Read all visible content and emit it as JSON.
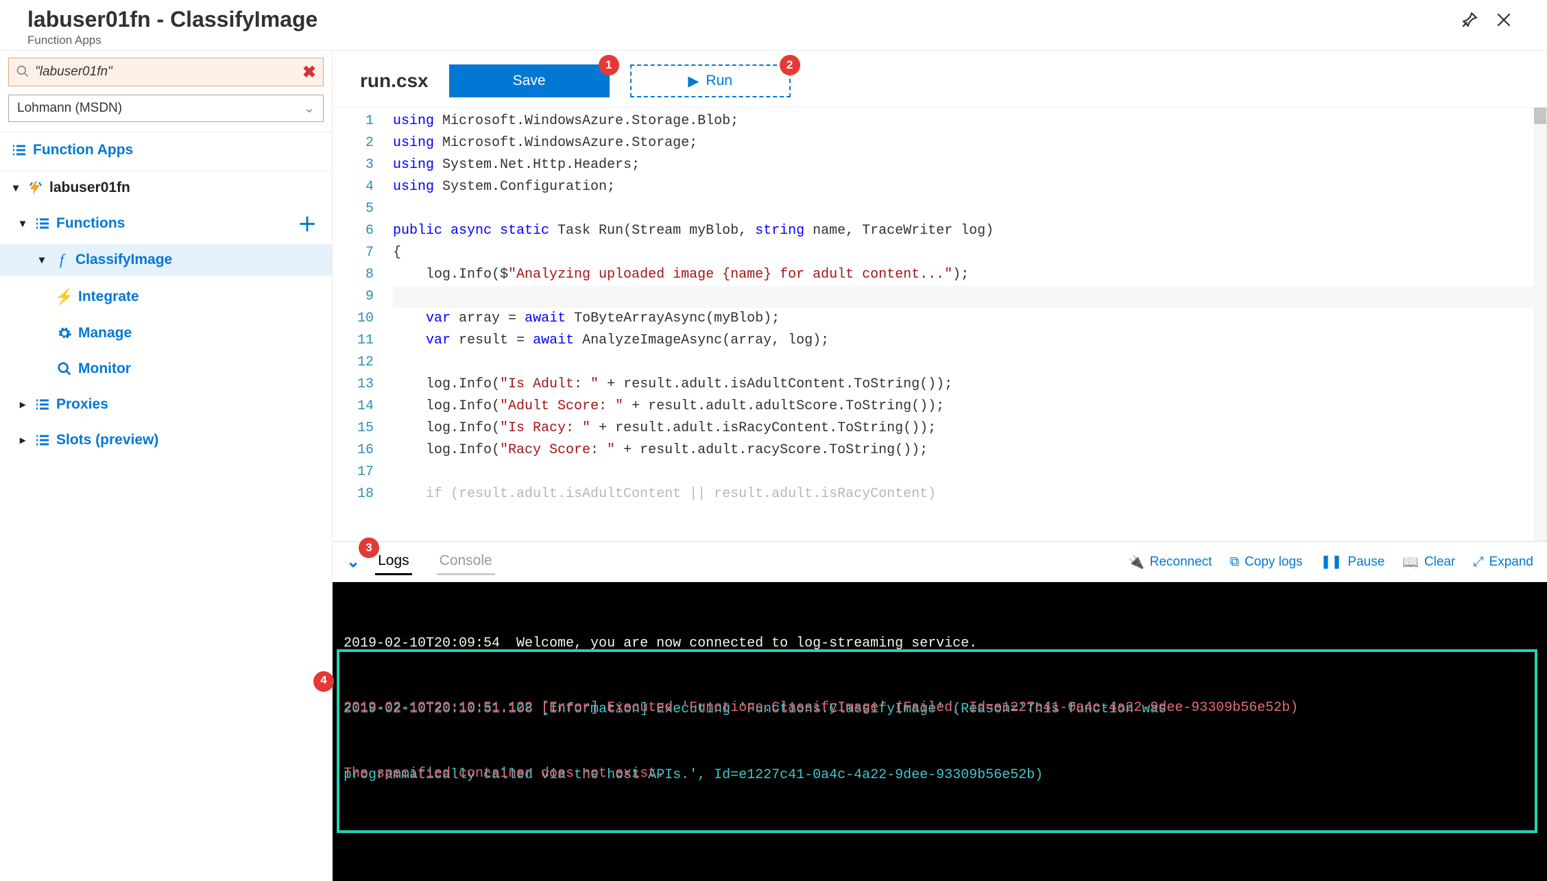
{
  "header": {
    "title": "labuser01fn - ClassifyImage",
    "subtitle": "Function Apps"
  },
  "sidebar": {
    "search_value": "\"labuser01fn\"",
    "subscription": "Lohmann (MSDN)",
    "nav": {
      "function_apps": "Function Apps",
      "app_name": "labuser01fn",
      "functions": "Functions",
      "selected_fn": "ClassifyImage",
      "integrate": "Integrate",
      "manage": "Manage",
      "monitor": "Monitor",
      "proxies": "Proxies",
      "slots": "Slots (preview)"
    }
  },
  "toolbar": {
    "filename": "run.csx",
    "save_label": "Save",
    "run_label": "Run"
  },
  "callouts": {
    "c1": "1",
    "c2": "2",
    "c3": "3",
    "c4": "4"
  },
  "code_lines": [
    [
      {
        "c": "kw",
        "t": "using"
      },
      {
        "c": "",
        "t": " Microsoft.WindowsAzure.Storage.Blob;"
      }
    ],
    [
      {
        "c": "kw",
        "t": "using"
      },
      {
        "c": "",
        "t": " Microsoft.WindowsAzure.Storage;"
      }
    ],
    [
      {
        "c": "kw",
        "t": "using"
      },
      {
        "c": "",
        "t": " System.Net.Http.Headers;"
      }
    ],
    [
      {
        "c": "kw",
        "t": "using"
      },
      {
        "c": "",
        "t": " System.Configuration;"
      }
    ],
    [
      {
        "c": "",
        "t": ""
      }
    ],
    [
      {
        "c": "kw",
        "t": "public async static"
      },
      {
        "c": "",
        "t": " Task Run(Stream myBlob, "
      },
      {
        "c": "kw",
        "t": "string"
      },
      {
        "c": "",
        "t": " name, TraceWriter log)"
      }
    ],
    [
      {
        "c": "",
        "t": "{"
      }
    ],
    [
      {
        "c": "",
        "t": "    log.Info($"
      },
      {
        "c": "str",
        "t": "\"Analyzing uploaded image {name} for adult content...\""
      },
      {
        "c": "",
        "t": ");"
      }
    ],
    [
      {
        "c": "",
        "t": ""
      }
    ],
    [
      {
        "c": "",
        "t": "    "
      },
      {
        "c": "kw",
        "t": "var"
      },
      {
        "c": "",
        "t": " array = "
      },
      {
        "c": "kw",
        "t": "await"
      },
      {
        "c": "",
        "t": " ToByteArrayAsync(myBlob);"
      }
    ],
    [
      {
        "c": "",
        "t": "    "
      },
      {
        "c": "kw",
        "t": "var"
      },
      {
        "c": "",
        "t": " result = "
      },
      {
        "c": "kw",
        "t": "await"
      },
      {
        "c": "",
        "t": " AnalyzeImageAsync(array, log);"
      }
    ],
    [
      {
        "c": "",
        "t": ""
      }
    ],
    [
      {
        "c": "",
        "t": "    log.Info("
      },
      {
        "c": "str",
        "t": "\"Is Adult: \""
      },
      {
        "c": "",
        "t": " + result.adult.isAdultContent.ToString());"
      }
    ],
    [
      {
        "c": "",
        "t": "    log.Info("
      },
      {
        "c": "str",
        "t": "\"Adult Score: \""
      },
      {
        "c": "",
        "t": " + result.adult.adultScore.ToString());"
      }
    ],
    [
      {
        "c": "",
        "t": "    log.Info("
      },
      {
        "c": "str",
        "t": "\"Is Racy: \""
      },
      {
        "c": "",
        "t": " + result.adult.isRacyContent.ToString());"
      }
    ],
    [
      {
        "c": "",
        "t": "    log.Info("
      },
      {
        "c": "str",
        "t": "\"Racy Score: \""
      },
      {
        "c": "",
        "t": " + result.adult.racyScore.ToString());"
      }
    ],
    [
      {
        "c": "",
        "t": ""
      }
    ],
    [
      {
        "c": "fade",
        "t": "    if (result.adult.isAdultContent || result.adult.isRacyContent)"
      }
    ]
  ],
  "logs": {
    "tabs": {
      "logs": "Logs",
      "console": "Console"
    },
    "actions": {
      "reconnect": "Reconnect",
      "copy": "Copy logs",
      "pause": "Pause",
      "clear": "Clear",
      "expand": "Expand"
    },
    "lines": {
      "welcome": "2019-02-10T20:09:54  Welcome, you are now connected to log-streaming service.",
      "info1": "2019-02-10T20:10:51.108 [Information] Executing 'Functions.ClassifyImage' (Reason='This function was",
      "info2": "programmatically called via the host APIs.', Id=e1227c41-0a4c-4a22-9dee-93309b56e52b)",
      "err1": "2019-02-10T20:10:51.122 [Error] Executed 'Functions.ClassifyImage' (Failed, Id=e1227c41-0a4c-4a22-9dee-93309b56e52b)",
      "err2": "The specified container does not exist."
    }
  }
}
